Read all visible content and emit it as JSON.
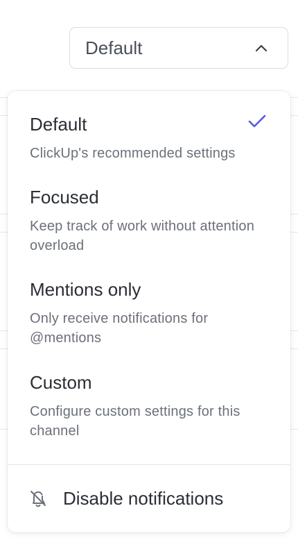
{
  "select": {
    "value": "Default",
    "icon": "chevron-up-icon"
  },
  "menu": {
    "options": [
      {
        "title": "Default",
        "description": "ClickUp's recommended settings",
        "selected": true
      },
      {
        "title": "Focused",
        "description": "Keep track of work without attention overload",
        "selected": false
      },
      {
        "title": "Mentions only",
        "description": "Only receive notifications for @mentions",
        "selected": false
      },
      {
        "title": "Custom",
        "description": "Configure custom settings for this channel",
        "selected": false
      }
    ],
    "check_icon": "check-icon",
    "disable": {
      "label": "Disable notifications",
      "icon": "bell-off-icon"
    }
  },
  "colors": {
    "accent": "#5a55e0",
    "text": "#2a2e34",
    "muted": "#6b7079",
    "border": "#dadde2"
  }
}
